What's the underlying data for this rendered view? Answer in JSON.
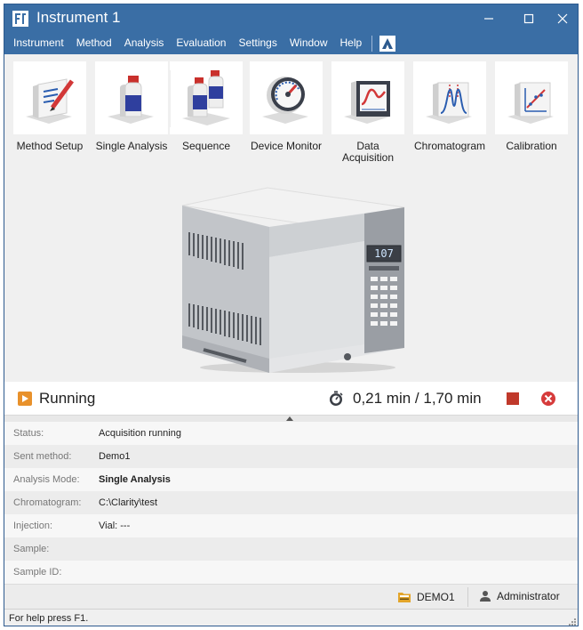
{
  "window": {
    "title": "Instrument 1"
  },
  "menu": {
    "items": [
      "Instrument",
      "Method",
      "Analysis",
      "Evaluation",
      "Settings",
      "Window",
      "Help"
    ]
  },
  "toolbar": {
    "tools": [
      {
        "label": "Method Setup",
        "icon": "method-setup-icon"
      },
      {
        "label": "Single Analysis",
        "icon": "single-analysis-icon"
      },
      {
        "label": "Sequence",
        "icon": "sequence-icon"
      },
      {
        "label": "Device Monitor",
        "icon": "device-monitor-icon"
      },
      {
        "label": "Data Acquisition",
        "icon": "data-acquisition-icon"
      },
      {
        "label": "Chromatogram",
        "icon": "chromatogram-icon"
      },
      {
        "label": "Calibration",
        "icon": "calibration-icon"
      }
    ]
  },
  "instrument": {
    "display": "107"
  },
  "run": {
    "state": "Running",
    "time": "0,21 min / 1,70 min"
  },
  "info": {
    "rows": [
      {
        "label": "Status:",
        "value": "Acquisition running",
        "bold": false
      },
      {
        "label": "Sent method:",
        "value": "Demo1",
        "bold": false
      },
      {
        "label": "Analysis Mode:",
        "value": "Single Analysis",
        "bold": true
      },
      {
        "label": "Chromatogram:",
        "value": "C:\\Clarity\\test",
        "bold": false
      },
      {
        "label": "Injection:",
        "value": "Vial: ---",
        "bold": false
      },
      {
        "label": "Sample:",
        "value": "",
        "bold": false
      },
      {
        "label": "Sample ID:",
        "value": "",
        "bold": false
      }
    ]
  },
  "footer": {
    "project": "DEMO1",
    "user": "Administrator"
  },
  "help": {
    "text": "For help press F1."
  },
  "colors": {
    "title_bar": "#3a6ea5",
    "running_orange": "#e8912b",
    "stop_red": "#c0392b",
    "abort_red": "#d63b3b"
  }
}
